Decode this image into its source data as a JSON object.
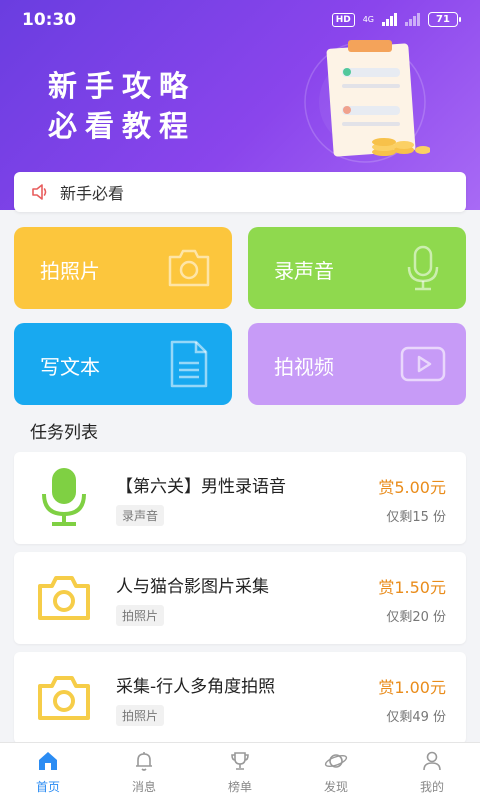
{
  "status_bar": {
    "time": "10:30",
    "hd": "HD",
    "network": "4G",
    "battery": "71"
  },
  "banner": {
    "line1": "新手攻略",
    "line2": "必看教程"
  },
  "notice": {
    "text": "新手必看"
  },
  "categories": [
    {
      "label": "拍照片",
      "icon": "camera-icon",
      "color": "#fcc63d"
    },
    {
      "label": "录声音",
      "icon": "microphone-icon",
      "color": "#8fd94e"
    },
    {
      "label": "写文本",
      "icon": "document-icon",
      "color": "#18a9f0"
    },
    {
      "label": "拍视频",
      "icon": "video-play-icon",
      "color": "#c79bf7"
    }
  ],
  "section_title": "任务列表",
  "tasks": [
    {
      "title": "【第六关】男性录语音",
      "tag": "录声音",
      "reward": "赏5.00元",
      "remaining": "仅剩15 份",
      "icon": "microphone-icon"
    },
    {
      "title": "人与猫合影图片采集",
      "tag": "拍照片",
      "reward": "赏1.50元",
      "remaining": "仅剩20 份",
      "icon": "camera-icon"
    },
    {
      "title": "采集-行人多角度拍照",
      "tag": "拍照片",
      "reward": "赏1.00元",
      "remaining": "仅剩49 份",
      "icon": "camera-icon"
    }
  ],
  "tabbar": [
    {
      "label": "首页",
      "icon": "home-icon",
      "active": true
    },
    {
      "label": "消息",
      "icon": "bell-icon"
    },
    {
      "label": "榜单",
      "icon": "trophy-icon"
    },
    {
      "label": "发现",
      "icon": "planet-icon"
    },
    {
      "label": "我的",
      "icon": "user-icon"
    }
  ],
  "colors": {
    "accent": "#2b8cf3",
    "reward": "#e98c1b",
    "header_start": "#6a3de0",
    "header_end": "#a86af5"
  }
}
